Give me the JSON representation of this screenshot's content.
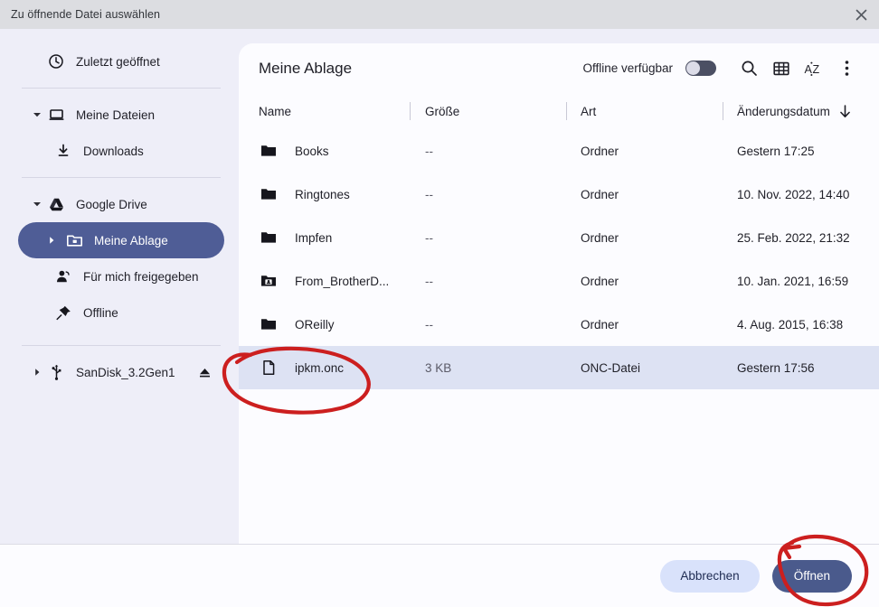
{
  "window": {
    "title": "Zu öffnende Datei auswählen",
    "close_icon": "close-icon"
  },
  "sidebar": {
    "items": [
      {
        "label": "Zuletzt geöffnet",
        "icon": "clock-icon",
        "level": 0,
        "twisty": "none",
        "selected": false
      },
      {
        "label": "Meine Dateien",
        "icon": "computer-icon",
        "level": 0,
        "twisty": "expanded",
        "selected": false
      },
      {
        "label": "Downloads",
        "icon": "download-icon",
        "level": 1,
        "twisty": "none",
        "selected": false
      },
      {
        "label": "Google Drive",
        "icon": "google-drive-icon",
        "level": 0,
        "twisty": "expanded",
        "selected": false
      },
      {
        "label": "Meine Ablage",
        "icon": "my-drive-folder-icon",
        "level": 1,
        "twisty": "collapsed",
        "selected": true
      },
      {
        "label": "Für mich freigegeben",
        "icon": "shared-with-me-icon",
        "level": 1,
        "twisty": "none",
        "selected": false
      },
      {
        "label": "Offline",
        "icon": "pin-icon",
        "level": 1,
        "twisty": "none",
        "selected": false
      },
      {
        "label": "SanDisk_3.2Gen1",
        "icon": "usb-icon",
        "level": 0,
        "twisty": "collapsed",
        "selected": false,
        "eject": "eject-icon"
      }
    ]
  },
  "main": {
    "title": "Meine Ablage",
    "offline_label": "Offline verfügbar",
    "offline_toggle_state": "off",
    "tools": [
      {
        "name": "search-icon"
      },
      {
        "name": "grid-view-icon"
      },
      {
        "name": "sort-az-icon"
      },
      {
        "name": "more-options-icon"
      }
    ],
    "columns": [
      {
        "key": "name",
        "label": "Name",
        "sorted": false
      },
      {
        "key": "size",
        "label": "Größe",
        "sorted": false
      },
      {
        "key": "type",
        "label": "Art",
        "sorted": false
      },
      {
        "key": "date",
        "label": "Änderungsdatum",
        "sorted": true,
        "sort_direction": "descending"
      }
    ],
    "rows": [
      {
        "name": "Books",
        "size": "--",
        "type": "Ordner",
        "date": "Gestern 17:25",
        "icon": "folder-icon",
        "selected": false
      },
      {
        "name": "Ringtones",
        "size": "--",
        "type": "Ordner",
        "date": "10. Nov. 2022, 14:40",
        "icon": "folder-icon",
        "selected": false
      },
      {
        "name": "Impfen",
        "size": "--",
        "type": "Ordner",
        "date": "25. Feb. 2022, 21:32",
        "icon": "folder-icon",
        "selected": false
      },
      {
        "name": "From_BrotherD...",
        "size": "--",
        "type": "Ordner",
        "date": "10. Jan. 2021, 16:59",
        "icon": "shared-folder-icon",
        "selected": false
      },
      {
        "name": "OReilly",
        "size": "--",
        "type": "Ordner",
        "date": "4. Aug. 2015, 16:38",
        "icon": "folder-icon",
        "selected": false
      },
      {
        "name": "ipkm.onc",
        "size": "3 KB",
        "type": "ONC-Datei",
        "date": "Gestern 17:56",
        "icon": "file-icon",
        "selected": true
      }
    ]
  },
  "footer": {
    "cancel_label": "Abbrechen",
    "open_label": "Öffnen"
  },
  "colors": {
    "titlebar_bg": "#dcdde1",
    "sidebar_bg": "#eeeef8",
    "panel_bg": "#fcfcff",
    "accent": "#4f5d96",
    "selected_row_bg": "#dde2f3",
    "cancel_btn_bg": "#d9e2fb",
    "open_btn_bg": "#4a5a8c",
    "annotation_red": "#cc1f1f"
  },
  "annotations": [
    {
      "name": "file-row-circle",
      "target": "ipkm.onc row"
    },
    {
      "name": "open-button-circle",
      "target": "Öffnen button"
    }
  ]
}
